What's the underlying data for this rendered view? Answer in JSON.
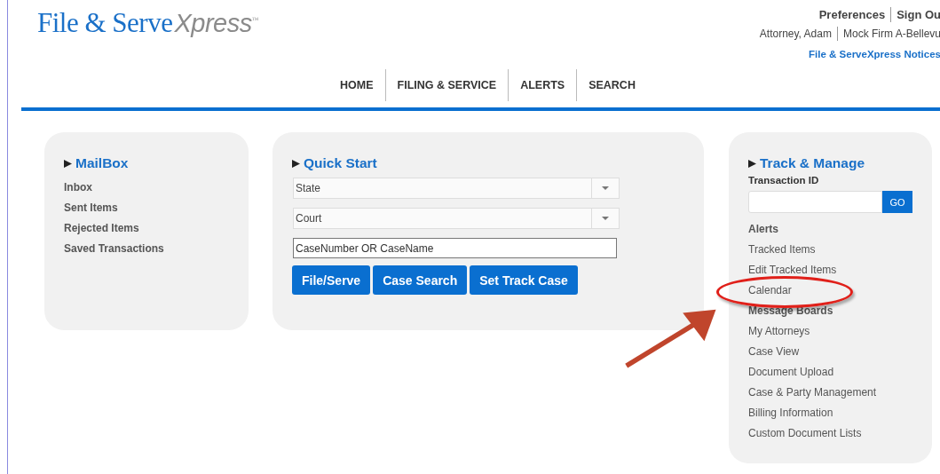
{
  "logo": {
    "text": "File & Serve",
    "accent": "Xpress",
    "mark": "™"
  },
  "user_links": [
    "Preferences",
    "Sign Ou"
  ],
  "user_info": [
    "Attorney, Adam",
    "Mock Firm A-Bellevu"
  ],
  "notices_link": "File & ServeXpress Notices",
  "nav": [
    {
      "label": "HOME",
      "selected": false
    },
    {
      "label": "FILING & SERVICE",
      "selected": false
    },
    {
      "label": "ALERTS",
      "selected": false
    },
    {
      "label": "SEARCH",
      "selected": false
    }
  ],
  "mailbox": {
    "title": "MailBox",
    "items": [
      "Inbox",
      "Sent Items",
      "Rejected Items",
      "Saved Transactions"
    ]
  },
  "quick_start": {
    "title": "Quick Start",
    "selects": [
      {
        "placeholder": "State"
      },
      {
        "placeholder": "Court"
      }
    ],
    "case_field": {
      "value": "CaseNumber OR CaseName"
    },
    "buttons": [
      "File/Serve",
      "Case Search",
      "Set Track Case"
    ]
  },
  "track_manage": {
    "title": "Track & Manage",
    "field_label": "Transaction ID",
    "go_button": "GO",
    "items": [
      {
        "kind": "heading",
        "label": "Alerts",
        "highlighted": false
      },
      {
        "kind": "link",
        "label": "Tracked Items",
        "highlighted": false
      },
      {
        "kind": "link",
        "label": "Edit Tracked Items",
        "highlighted": false
      },
      {
        "kind": "link",
        "label": "Calendar",
        "highlighted": true
      },
      {
        "kind": "heading",
        "label": "Message Boards",
        "highlighted": false
      },
      {
        "kind": "link",
        "label": "My Attorneys",
        "highlighted": false
      },
      {
        "kind": "link",
        "label": "Case View",
        "highlighted": false
      },
      {
        "kind": "link",
        "label": "Document Upload",
        "highlighted": false
      },
      {
        "kind": "link",
        "label": "Case & Party Management",
        "highlighted": false
      },
      {
        "kind": "link",
        "label": "Billing Information",
        "highlighted": false
      },
      {
        "kind": "link",
        "label": "Custom Document Lists",
        "highlighted": false
      }
    ]
  }
}
